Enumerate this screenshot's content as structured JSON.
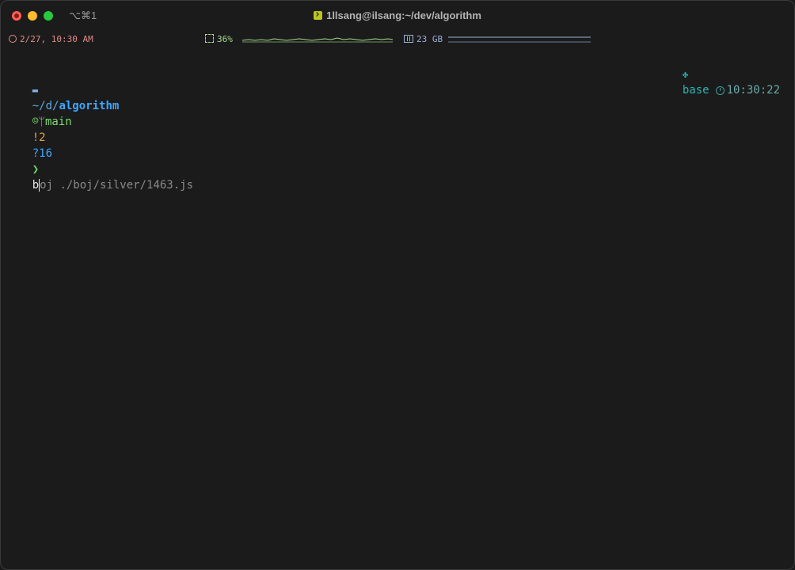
{
  "window": {
    "shortcut": "⌥⌘1",
    "title": "1llsang@ilsang:~/dev/algorithm"
  },
  "statusbar": {
    "datetime": "2/27, 10:30 AM",
    "cpu_label": "36%",
    "cpu_percent": 36,
    "memory_label": "23 GB",
    "colors": {
      "clock": "#e08a86",
      "cpu": "#a6dd8e",
      "memory": "#9bb0d8"
    }
  },
  "prompt": {
    "os_icon": "apple-icon",
    "dir_icon": "folder-icon",
    "path_prefix": "~/d/",
    "path_current": "algorithm",
    "vcs_icon": "github-icon",
    "branch_icon": "git-branch-icon",
    "branch": "main",
    "modified": "!2",
    "untracked": "?16",
    "prompt_char": "❯",
    "command_typed_first": "b",
    "command_rest": "oj ./boj/silver/1463.js",
    "env_icon": "python-icon",
    "env": "base",
    "time_icon": "clock-icon",
    "time": "10:30:22",
    "colors": {
      "path": "#3ea7ff",
      "branch": "#7cdc6d",
      "modified": "#e0a540",
      "env": "#2fb3b3"
    }
  }
}
